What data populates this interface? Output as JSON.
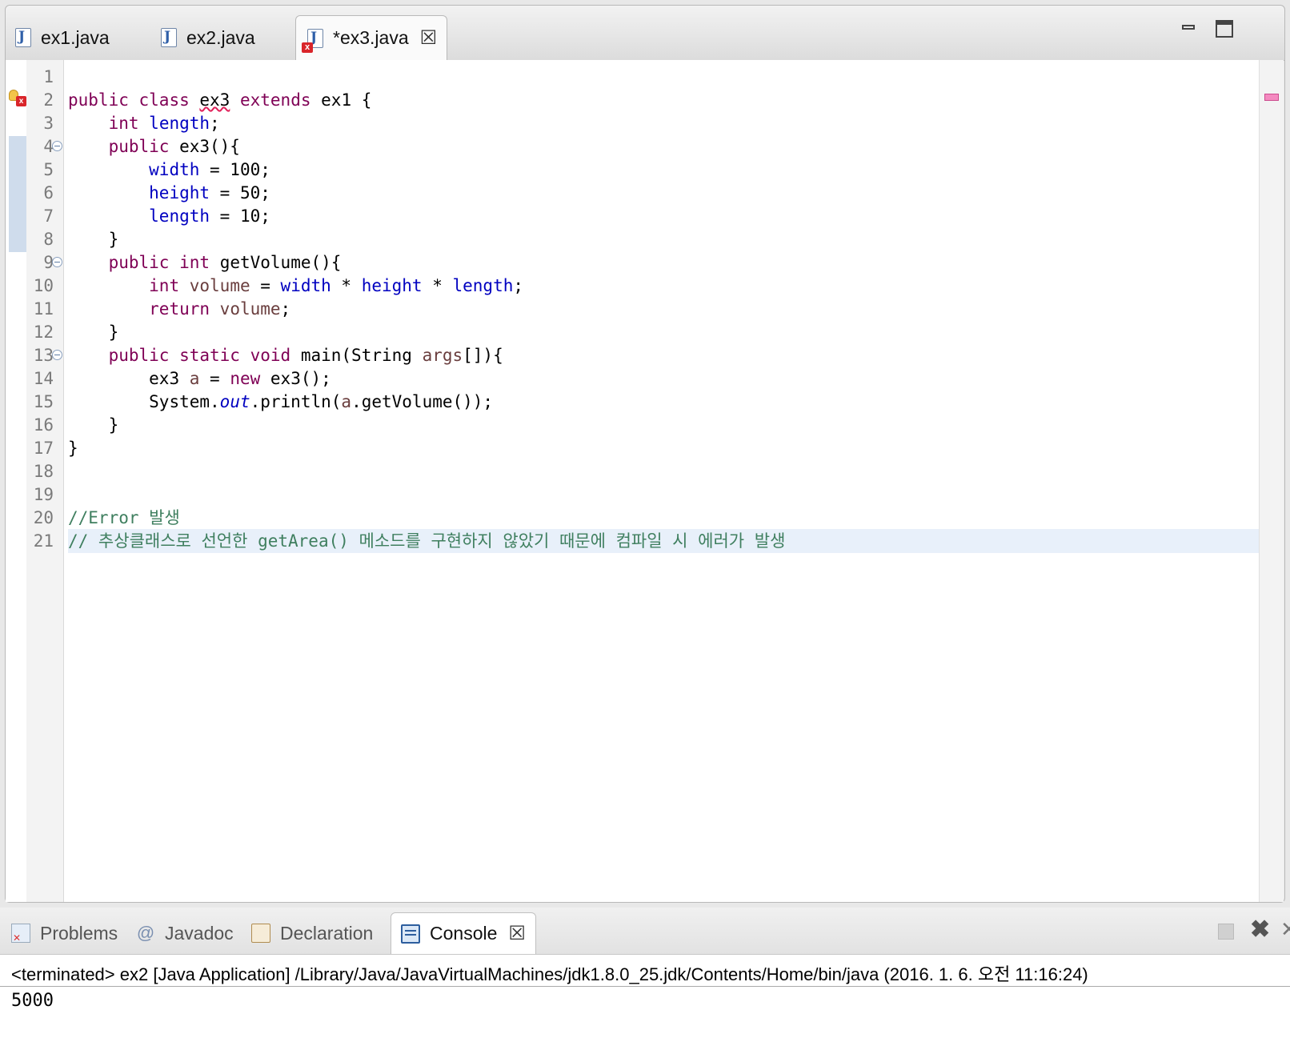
{
  "editor": {
    "tabs": [
      {
        "label": "ex1.java",
        "icon": "java-file-icon",
        "active": false,
        "error": false
      },
      {
        "label": "ex2.java",
        "icon": "java-file-icon",
        "active": false,
        "error": false
      },
      {
        "label": "*ex3.java",
        "icon": "java-file-error-icon",
        "active": true,
        "error": true
      }
    ],
    "close_glyph": "☒",
    "line_numbers": [
      "1",
      "2",
      "3",
      "4",
      "5",
      "6",
      "7",
      "8",
      "9",
      "10",
      "11",
      "12",
      "13",
      "14",
      "15",
      "16",
      "17",
      "18",
      "19",
      "20",
      "21"
    ],
    "code": {
      "l2": {
        "public": "public",
        "class": "class",
        "classname": "ex3",
        "extends": "extends",
        "superclass": "ex1 {"
      },
      "l3": {
        "int": "int",
        "field": "length",
        "semi": ";"
      },
      "l4": {
        "public": "public",
        "rest": "ex3(){"
      },
      "l5": {
        "field": "width",
        "rest": " = 100;"
      },
      "l6": {
        "field": "height",
        "rest": " = 50;"
      },
      "l7": {
        "field": "length",
        "rest": " = 10;"
      },
      "l8": "}",
      "l9": {
        "public": "public",
        "int": "int",
        "rest": "getVolume(){"
      },
      "l10": {
        "int": "int",
        "var": "volume",
        "eq": " = ",
        "f1": "width",
        "op1": " * ",
        "f2": "height",
        "op2": " * ",
        "f3": "length",
        "semi": ";"
      },
      "l11": {
        "return": "return",
        "var": "volume",
        "semi": ";"
      },
      "l12": "}",
      "l13": {
        "public": "public",
        "static": "static",
        "void": "void",
        "mid": "main(String ",
        "args": "args",
        "rest": "[]){"
      },
      "l14": {
        "type": "ex3 ",
        "var": "a",
        "eq": " = ",
        "new": "new",
        "rest": " ex3();"
      },
      "l15": {
        "sys": "System.",
        "out": "out",
        "mid": ".println(",
        "var": "a",
        "rest": ".getVolume());"
      },
      "l16": "}",
      "l17": "}",
      "l20": "//Error 발생",
      "l21": "// 추상클래스로 선언한 getArea() 메소드를 구현하지 않았기 때문에 컴파일 시 에러가 발생"
    }
  },
  "panel": {
    "tabs": [
      {
        "label": "Problems",
        "icon": "problems-icon"
      },
      {
        "label": "Javadoc",
        "icon": "javadoc-icon"
      },
      {
        "label": "Declaration",
        "icon": "declaration-icon"
      },
      {
        "label": "Console",
        "icon": "console-icon",
        "active": true
      }
    ],
    "close_glyph": "☒",
    "console_header": "<terminated> ex2 [Java Application] /Library/Java/JavaVirtualMachines/jdk1.8.0_25.jdk/Contents/Home/bin/java (2016. 1. 6. 오전 11:16:24)",
    "console_output": "5000"
  },
  "colors": {
    "keyword": "#7f0055",
    "field": "#0000c0",
    "local_var": "#6a3e3e",
    "comment": "#3f7f5f",
    "error": "#d9252a"
  }
}
